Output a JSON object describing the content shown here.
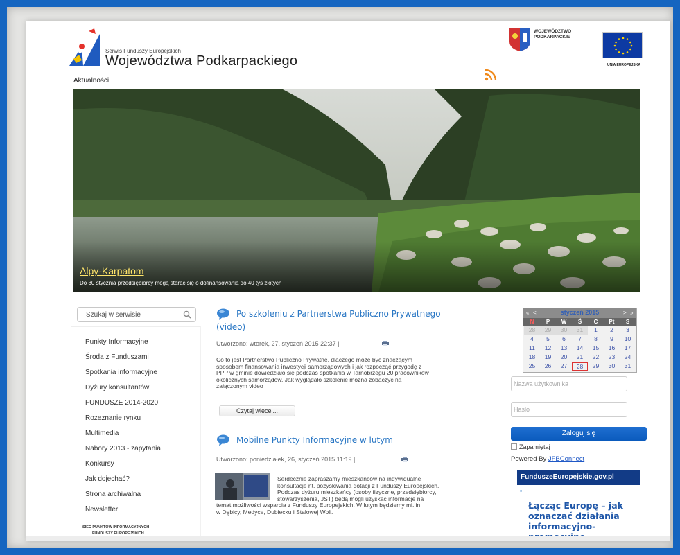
{
  "header": {
    "site_subtitle": "Serwis Funduszy Europejskich",
    "site_title": "Województwa Podkarpackiego",
    "top_link": "Aktualności",
    "region_label_line1": "WOJEWÓDZTWO",
    "region_label_line2": "PODKARPACKIE",
    "eu_label": "UNIA EUROPEJSKA"
  },
  "banner": {
    "title": "Alpy-Karpatom",
    "text": "Do 30 stycznia przedsiębiorcy mogą starać się o dofinansowania do 40 tys złotych"
  },
  "search": {
    "placeholder": "Szukaj w serwisie"
  },
  "menu": {
    "items": [
      "Punkty Informacyjne",
      "Środa z Funduszami",
      "Spotkania informacyjne",
      "Dyżury konsultantów",
      "FUNDUSZE 2014-2020",
      "Rozeznanie rynku",
      "Multimedia",
      "Nabory 2013 - zapytania",
      "Konkursy",
      "Jak dojechać?",
      "Strona archiwalna",
      "Newsletter"
    ],
    "footer_line1": "SIEĆ PUNKTÓW INFORMACYJNYCH",
    "footer_line2": "FUNDUSZY EUROPEJSKICH"
  },
  "articles": [
    {
      "title_line1": "Po szkoleniu z Partnerstwa Publiczno Prywatnego",
      "title_line2": "(video)",
      "meta": "Utworzono: wtorek, 27, styczeń 2015 22:37 |",
      "body_lines": [
        "Co to jest Partnerstwo Publiczno Prywatne, dlaczego może być znaczącym",
        "sposobem finansowania inwestycji samorządowych i jak rozpocząć przygodę z",
        "PPP w gminie dowiedziało się podczas spotkania w Tarnobrzegu 20 pracowników",
        "okolicznych samorządów. Jak wyglądało szkolenie można zobaczyć na",
        "załączonym video"
      ],
      "read_more": "Czytaj więcej..."
    },
    {
      "title_line1": "Mobilne Punkty Informacyjne w lutym",
      "meta": "Utworzono: poniedziałek, 26, styczeń 2015 11:19 |",
      "body_lines": [
        "Serdecznie zapraszamy mieszkańców na indywidualne",
        "konsultacje nt. pozyskiwania dotacji z Funduszy Europejskich.",
        "Podczas dyżuru mieszkańcy (osoby fizyczne, przedsiębiorcy,",
        "stowarzyszenia, JST) będą mogli uzyskać informacje na",
        "temat możliwości wsparcia z Funduszy Europejskich. W lutym będziemy mi. in.",
        "w Dębicy, Medyce, Dubiecku i Stalowej Woli."
      ]
    }
  ],
  "calendar": {
    "prev_year": "«",
    "prev_month": "<",
    "month": "styczeń 2015",
    "next_month": ">",
    "next_year": "»",
    "day_headers": [
      "N",
      "P",
      "W",
      "Ś",
      "C",
      "Pt",
      "S"
    ],
    "weeks": [
      [
        "28",
        "29",
        "30",
        "31",
        "1",
        "2",
        "3"
      ],
      [
        "4",
        "5",
        "6",
        "7",
        "8",
        "9",
        "10"
      ],
      [
        "11",
        "12",
        "13",
        "14",
        "15",
        "16",
        "17"
      ],
      [
        "18",
        "19",
        "20",
        "21",
        "22",
        "23",
        "24"
      ],
      [
        "25",
        "26",
        "27",
        "28",
        "29",
        "30",
        "31"
      ]
    ],
    "today": "28"
  },
  "login": {
    "username_placeholder": "Nazwa użytkownika",
    "password_placeholder": "Hasło",
    "button": "Zaloguj się",
    "remember": "Zapamiętaj",
    "powered_prefix": "Powered By",
    "powered_link": "JFBConnect"
  },
  "sidebar": {
    "fe_logo": "FunduszeEuropejskie.gov.pl",
    "quote_mark": "\"",
    "promo_lines": [
      "Łącząc Europę – jak",
      "oznaczać działania",
      "informacyjno-",
      "promocyjne"
    ]
  },
  "colors": {
    "outer_bg": "#1565c0",
    "link_blue": "#2a77c4",
    "login_button": "#0b5bbd",
    "fe_logo_bg": "#123b86"
  }
}
